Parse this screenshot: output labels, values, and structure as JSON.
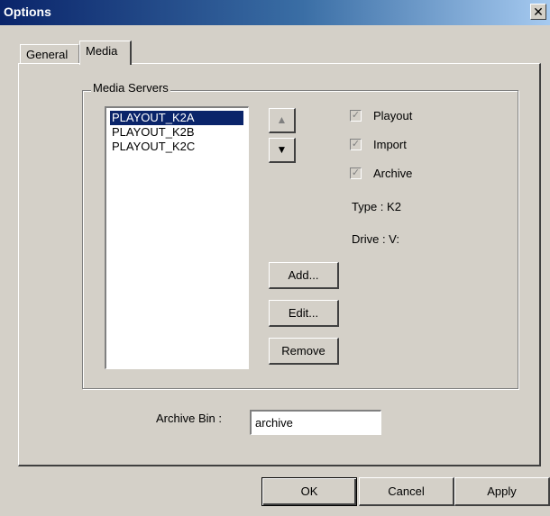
{
  "window": {
    "title": "Options",
    "close_symbol": "✕"
  },
  "tabs": [
    {
      "label": "General",
      "active": false
    },
    {
      "label": "Media",
      "active": true
    }
  ],
  "media_servers": {
    "group_label": "Media Servers",
    "servers": [
      "PLAYOUT_K2A",
      "PLAYOUT_K2B",
      "PLAYOUT_K2C"
    ],
    "selected": "PLAYOUT_K2A",
    "move_up_icon": "▲",
    "move_down_icon": "▼",
    "buttons": {
      "add": "Add...",
      "edit": "Edit...",
      "remove": "Remove"
    },
    "options": [
      {
        "label": "Playout",
        "checked": true,
        "disabled": true
      },
      {
        "label": "Import",
        "checked": true,
        "disabled": true
      },
      {
        "label": "Archive",
        "checked": true,
        "disabled": true
      }
    ],
    "type_text": "Type :  K2",
    "drive_text": "Drive :  V:"
  },
  "archive_bin": {
    "label": "Archive Bin :",
    "value": "archive"
  },
  "dialog_buttons": {
    "ok": "OK",
    "cancel": "Cancel",
    "apply": "Apply"
  }
}
